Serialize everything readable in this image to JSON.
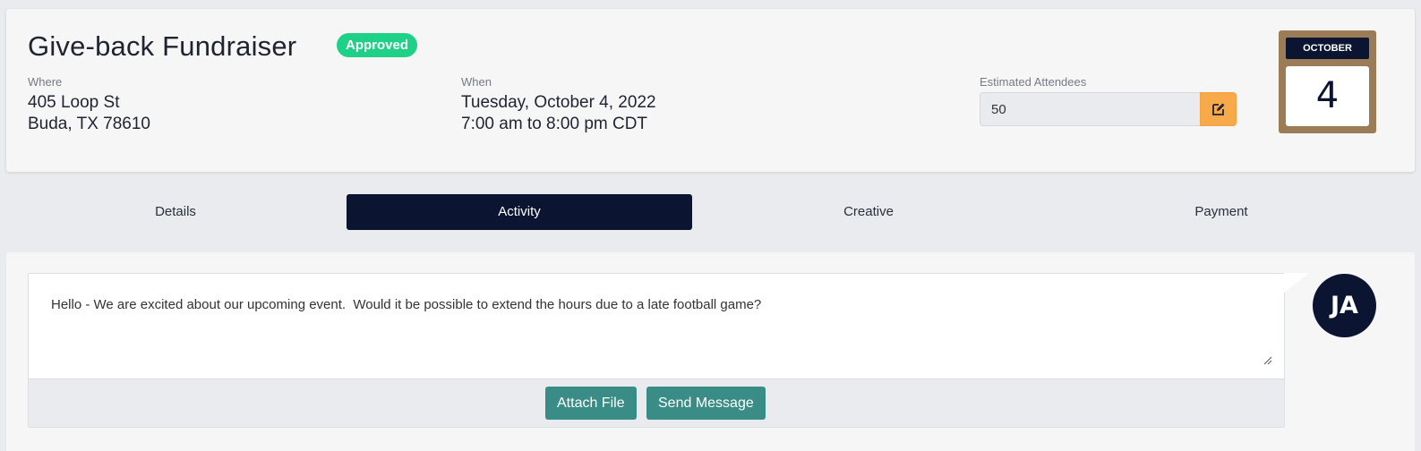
{
  "event": {
    "title": "Give-back Fundraiser",
    "status": "Approved",
    "where_label": "Where",
    "address_line1": "405 Loop St",
    "address_line2": "Buda, TX 78610",
    "when_label": "When",
    "date": "Tuesday, October 4, 2022",
    "time": "7:00 am to 8:00 pm CDT",
    "attendees_label": "Estimated Attendees",
    "attendees_value": "50",
    "edit_icon": "edit-icon"
  },
  "calendar": {
    "month": "OCTOBER",
    "day": "4"
  },
  "tabs": [
    {
      "label": "Details"
    },
    {
      "label": "Activity",
      "active": true
    },
    {
      "label": "Creative"
    },
    {
      "label": "Payment"
    }
  ],
  "message": {
    "text": "Hello - We are excited about our upcoming event.  Would it be possible to extend the hours due to a late football game?",
    "attach_label": "Attach File",
    "send_label": "Send Message"
  },
  "user": {
    "initials": "JA"
  },
  "colors": {
    "navy": "#0b1532",
    "approved": "#1fd187",
    "edit": "#f8a94a",
    "button": "#3a8c87",
    "calendar_frame": "#9c7c57"
  }
}
